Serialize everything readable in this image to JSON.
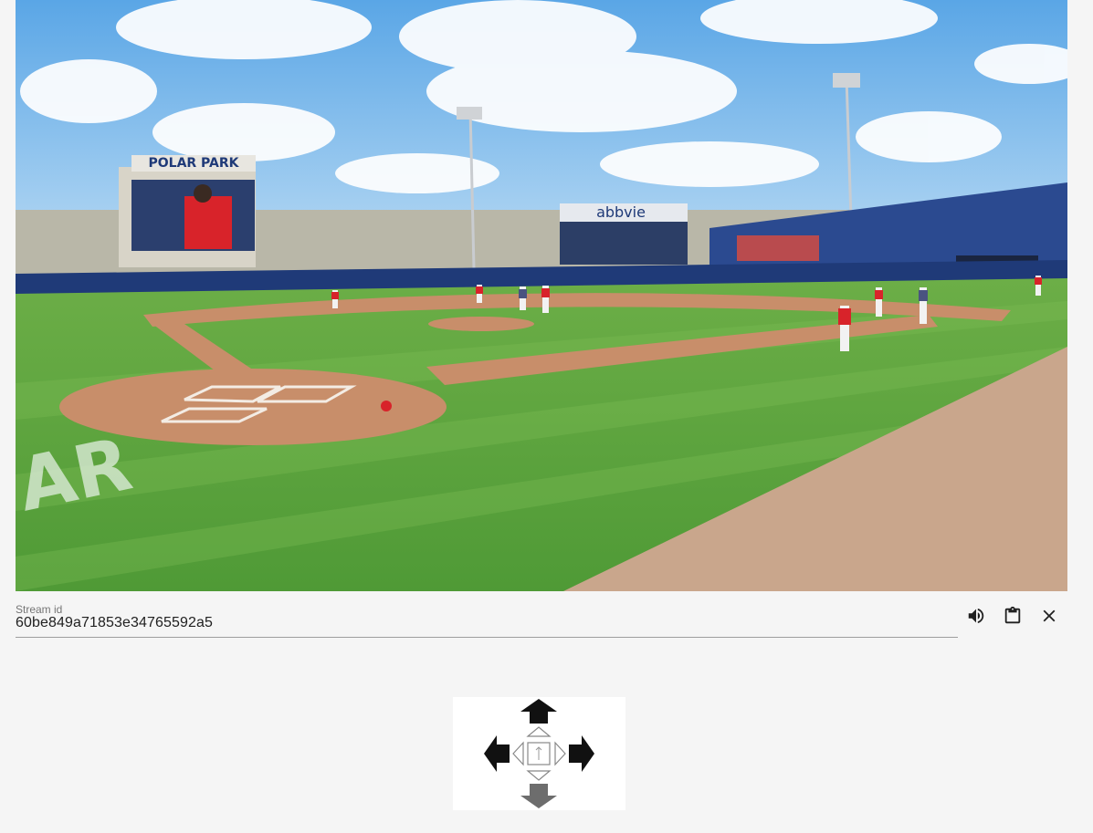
{
  "video": {
    "scoreboard_text": "POLAR PARK",
    "sign_text": "abbvie",
    "field_stencil_text": "AR"
  },
  "stream": {
    "label": "Stream id",
    "value": "60be849a71853e34765592a5"
  },
  "actions": [
    {
      "name": "volume-icon"
    },
    {
      "name": "clipboard-icon"
    },
    {
      "name": "close-icon"
    }
  ],
  "dpad": {
    "buttons": [
      "up",
      "left",
      "right",
      "down",
      "tilt-up",
      "tilt-left",
      "tilt-right",
      "tilt-down",
      "center"
    ]
  },
  "colors": {
    "background": "#f5f5f5",
    "text": "#212121",
    "label": "#757575",
    "grass": "#5aa83e",
    "dirt": "#c88e6a",
    "wall": "#1f3a78"
  }
}
